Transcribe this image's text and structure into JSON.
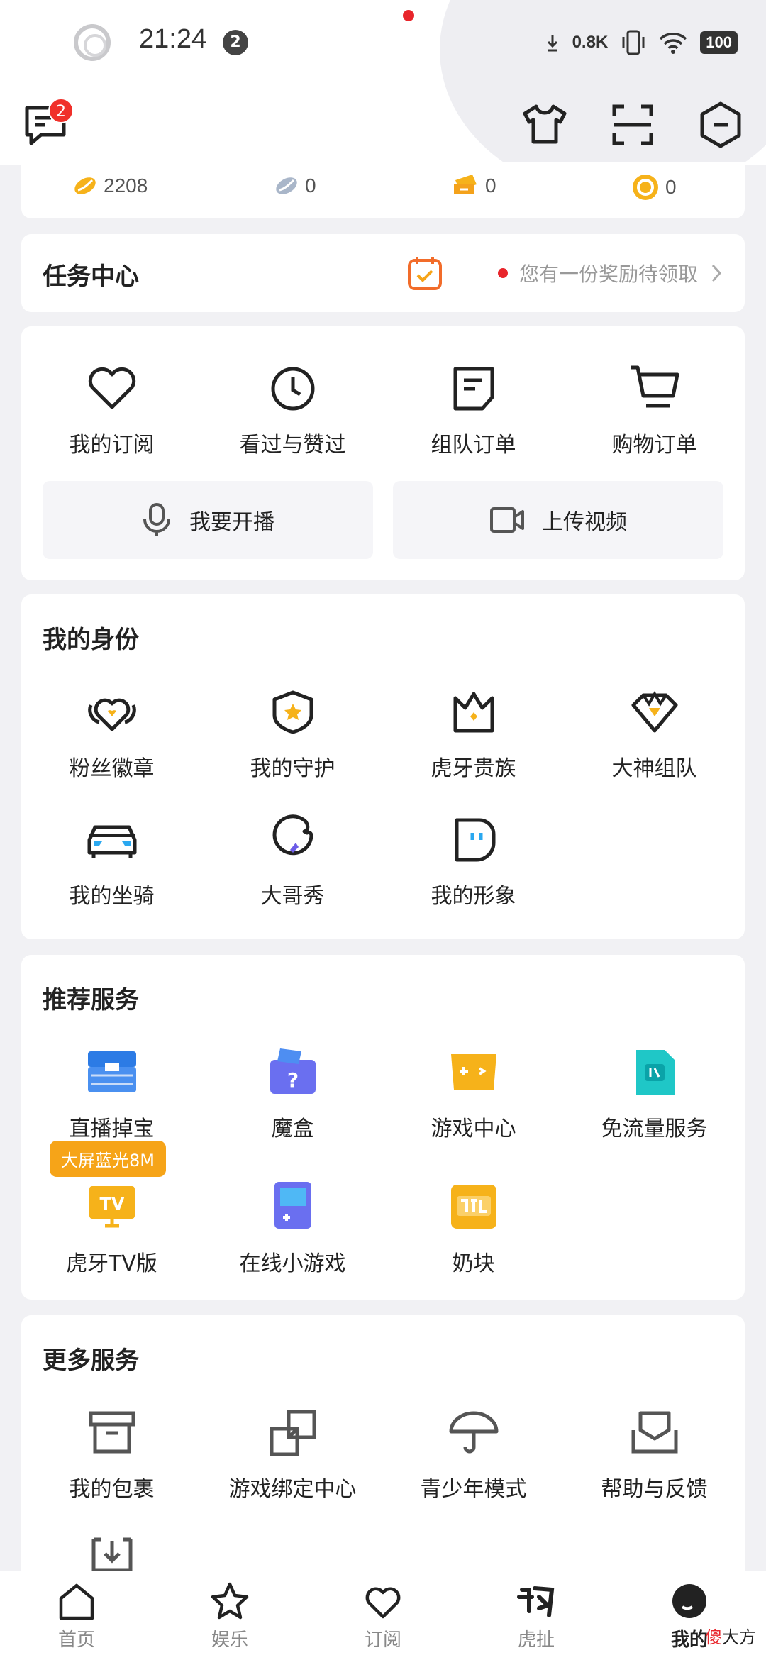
{
  "status_bar": {
    "time": "21:24",
    "notif_count": "2",
    "net_speed": "0.8K",
    "battery": "100"
  },
  "header": {
    "message_badge": "2"
  },
  "currencies": [
    {
      "icon": "gold-bean-icon",
      "value": "2208"
    },
    {
      "icon": "silver-bean-icon",
      "value": "0"
    },
    {
      "icon": "ticket-icon",
      "value": "0"
    },
    {
      "icon": "coin-icon",
      "value": "0"
    }
  ],
  "task_center": {
    "title": "任务中心",
    "reward_text": "您有一份奖励待领取"
  },
  "quick_links": [
    {
      "label": "我的订阅",
      "icon": "heart-icon"
    },
    {
      "label": "看过与赞过",
      "icon": "clock-icon"
    },
    {
      "label": "组队订单",
      "icon": "order-icon"
    },
    {
      "label": "购物订单",
      "icon": "cart-icon"
    }
  ],
  "actions": {
    "broadcast": "我要开播",
    "upload": "上传视频"
  },
  "identity": {
    "title": "我的身份",
    "items": [
      {
        "label": "粉丝徽章",
        "icon": "fan-badge-icon"
      },
      {
        "label": "我的守护",
        "icon": "guard-icon"
      },
      {
        "label": "虎牙贵族",
        "icon": "crown-icon"
      },
      {
        "label": "大神组队",
        "icon": "master-team-icon"
      },
      {
        "label": "我的坐骑",
        "icon": "car-icon"
      },
      {
        "label": "大哥秀",
        "icon": "brother-show-icon"
      },
      {
        "label": "我的形象",
        "icon": "avatar-look-icon"
      }
    ]
  },
  "recommended": {
    "title": "推荐服务",
    "promo_tag": "大屏蓝光8M",
    "items": [
      {
        "label": "直播掉宝",
        "icon": "treasure-box-icon"
      },
      {
        "label": "魔盒",
        "icon": "mystery-box-icon"
      },
      {
        "label": "游戏中心",
        "icon": "game-center-icon"
      },
      {
        "label": "免流量服务",
        "icon": "sim-card-icon"
      },
      {
        "label": "虎牙TV版",
        "icon": "tv-icon"
      },
      {
        "label": "在线小游戏",
        "icon": "handheld-game-icon"
      },
      {
        "label": "奶块",
        "icon": "naikuai-icon"
      }
    ]
  },
  "more_services": {
    "title": "更多服务",
    "items": [
      {
        "label": "我的包裹",
        "icon": "package-icon"
      },
      {
        "label": "游戏绑定中心",
        "icon": "link-icon"
      },
      {
        "label": "青少年模式",
        "icon": "umbrella-icon"
      },
      {
        "label": "帮助与反馈",
        "icon": "inbox-icon"
      }
    ]
  },
  "tabs": [
    {
      "label": "首页",
      "icon": "home-icon"
    },
    {
      "label": "娱乐",
      "icon": "star-icon"
    },
    {
      "label": "订阅",
      "icon": "heart-icon"
    },
    {
      "label": "虎扯",
      "icon": "huche-icon"
    },
    {
      "label": "我的",
      "icon": "profile-icon"
    }
  ],
  "watermark": {
    "prefix": "傻",
    "suffix": "大方"
  },
  "colors": {
    "accent": "#f6a418",
    "red": "#e8252b",
    "bg": "#f1f1f4"
  }
}
